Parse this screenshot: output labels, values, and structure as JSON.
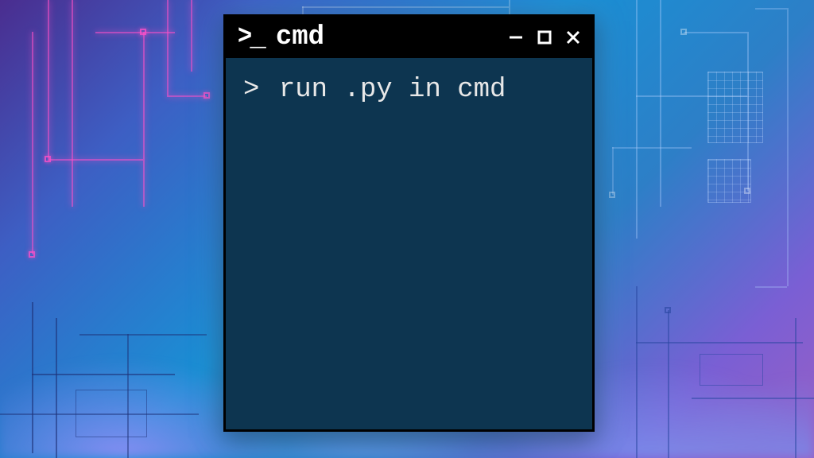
{
  "window": {
    "title": "cmd",
    "icon_name": "prompt-icon"
  },
  "terminal": {
    "prompt": ">",
    "command": "run .py in cmd"
  },
  "controls": {
    "minimize_label": "Minimize",
    "maximize_label": "Maximize",
    "close_label": "Close"
  },
  "colors": {
    "titlebar_bg": "#000000",
    "terminal_bg": "#0d3550",
    "text": "#e8e8e8"
  }
}
